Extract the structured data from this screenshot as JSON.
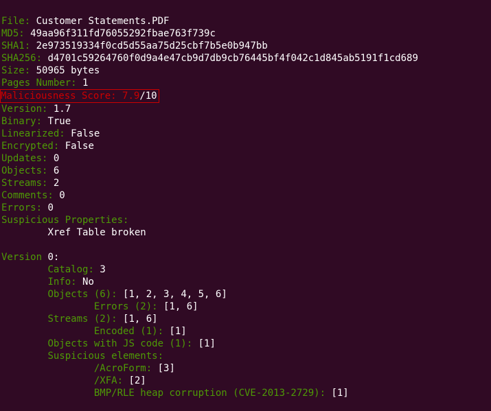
{
  "header": {
    "file_label": "File:",
    "file_value": "Customer Statements.PDF",
    "md5_label": "MD5:",
    "md5_value": "49aa96f311fd76055292fbae763f739c",
    "sha1_label": "SHA1:",
    "sha1_value": "2e973519334f0cd5d55aa75d25cbf7b5e0b947bb",
    "sha256_label": "SHA256:",
    "sha256_value": "d4701c59264760f0d9a4e47cb9d7db9cb76445bf4f042c1d845ab5191f1cd689",
    "size_label": "Size:",
    "size_value": "50965 bytes",
    "pages_label": "Pages Number:",
    "pages_value": "1",
    "mal_label": "Maliciousness Score:",
    "mal_score": "7.9",
    "mal_denom": "/10",
    "version_label": "Version:",
    "version_value": "1.7",
    "binary_label": "Binary:",
    "binary_value": "True",
    "linearized_label": "Linearized:",
    "linearized_value": "False",
    "encrypted_label": "Encrypted:",
    "encrypted_value": "False",
    "updates_label": "Updates:",
    "updates_value": "0",
    "objects_label": "Objects:",
    "objects_value": "6",
    "streams_label": "Streams:",
    "streams_value": "2",
    "comments_label": "Comments:",
    "comments_value": "0",
    "errors_label": "Errors:",
    "errors_value": "0",
    "susp_props_label": "Suspicious Properties:",
    "susp_props_value": "Xref Table broken"
  },
  "version0": {
    "heading_label": "Version",
    "heading_value": "0:",
    "catalog_label": "Catalog:",
    "catalog_value": "3",
    "info_label": "Info:",
    "info_value": "No",
    "objects6_label": "Objects (6):",
    "objects6_value": "[1, 2, 3, 4, 5, 6]",
    "errors2_label": "Errors (2):",
    "errors2_value": "[1, 6]",
    "streams2_label": "Streams (2):",
    "streams2_value": "[1, 6]",
    "encoded1_label": "Encoded (1):",
    "encoded1_value": "[1]",
    "objjs_label": "Objects with JS code (1):",
    "objjs_value": "[1]",
    "suspel_label": "Suspicious elements:",
    "acroform_label": "/AcroForm:",
    "acroform_value": "[3]",
    "xfa_label": "/XFA:",
    "xfa_value": "[2]",
    "bmp_label": "BMP/RLE heap corruption (CVE-2013-2729):",
    "bmp_value": "[1]"
  }
}
